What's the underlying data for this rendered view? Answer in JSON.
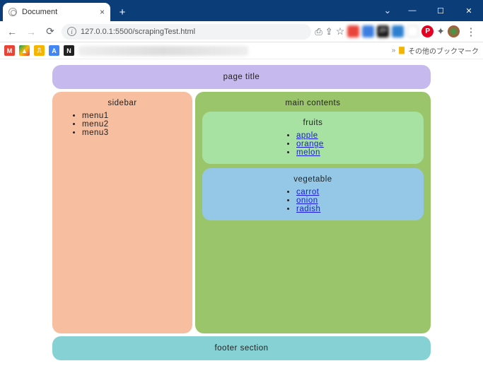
{
  "browser": {
    "tab_title": "Document",
    "url": "127.0.0.1:5500/scrapingTest.html",
    "bookmarks_folder": "その他のブックマーク"
  },
  "page": {
    "title": "page title",
    "sidebar": {
      "heading": "sidebar",
      "items": [
        "menu1",
        "menu2",
        "menu3"
      ]
    },
    "main": {
      "heading": "main contents",
      "sections": [
        {
          "heading": "fruits",
          "links": [
            "apple",
            "orange",
            "melon"
          ]
        },
        {
          "heading": "vegetable",
          "links": [
            "carrot",
            "onion",
            "radish"
          ]
        }
      ]
    },
    "footer": "footer section"
  }
}
